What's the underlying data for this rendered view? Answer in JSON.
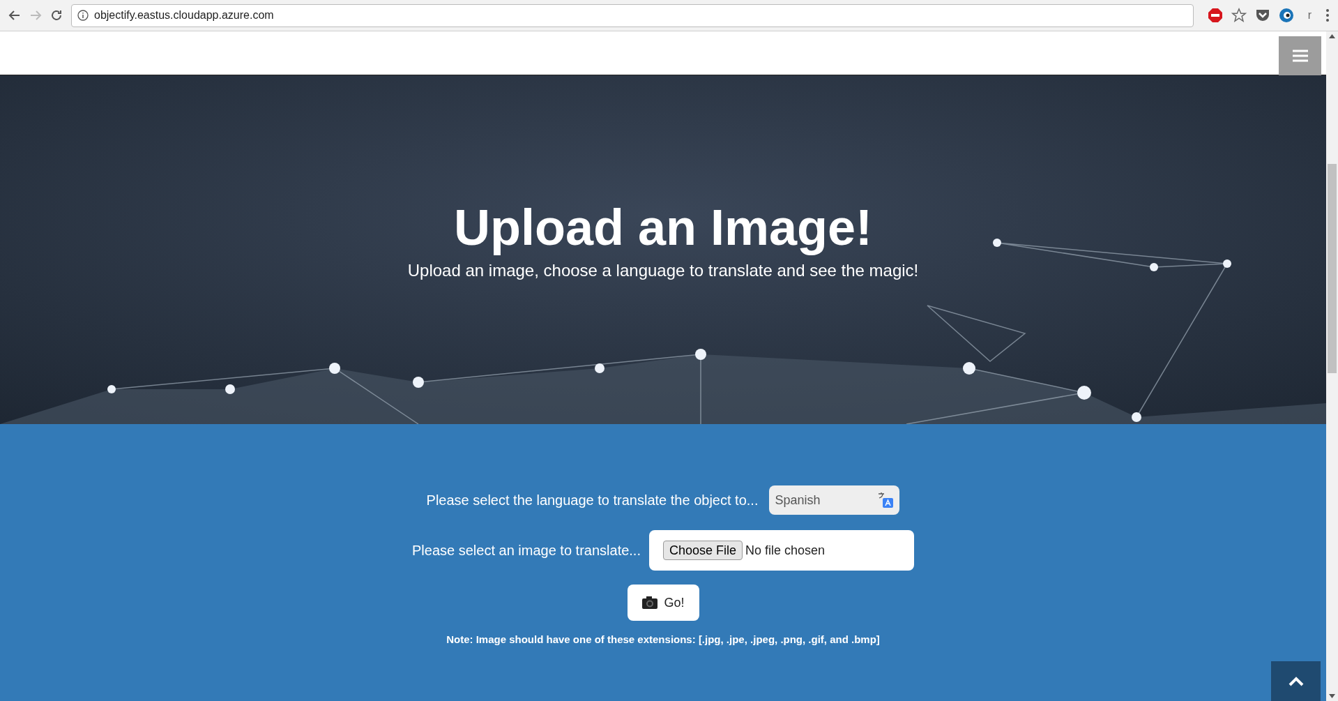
{
  "browser": {
    "address": "objectify.eastus.cloudapp.azure.com",
    "extension_letter": "r"
  },
  "hero": {
    "title": "Upload an Image!",
    "subtitle": "Upload an image, choose a language to translate and see the magic!"
  },
  "form": {
    "language_label": "Please select the language to translate the object to...",
    "language_value": "Spanish",
    "image_label": "Please select an image to translate...",
    "file_button": "Choose File",
    "file_status": "No file chosen",
    "go_button": "Go!",
    "note": "Note: Image should have one of these extensions: [.jpg, .jpe, .jpeg, .png, .gif, and .bmp]"
  }
}
